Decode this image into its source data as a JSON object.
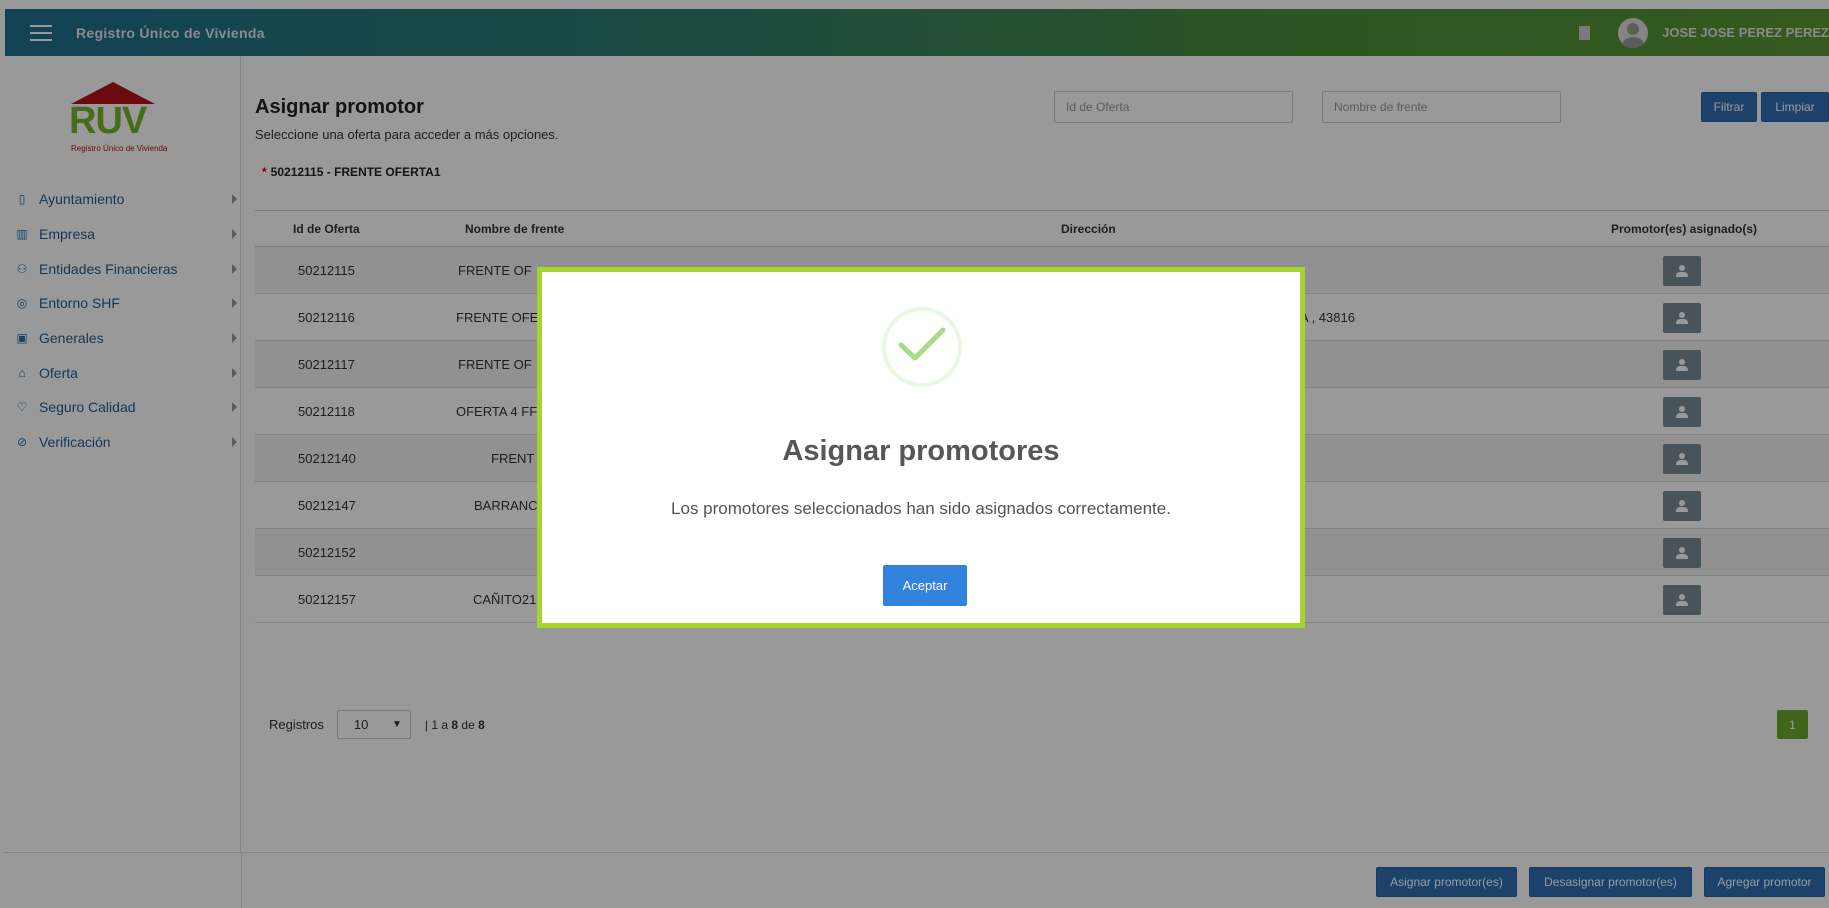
{
  "header": {
    "app_title": "Registro Único de Vivienda",
    "user_name": "JOSE JOSE PEREZ PEREZ"
  },
  "logo": {
    "text": "RUV",
    "subtitle": "Registro Único de Vivienda"
  },
  "sidebar": {
    "items": [
      {
        "label": "Ayuntamiento",
        "icon": "map-icon"
      },
      {
        "label": "Empresa",
        "icon": "building-icon"
      },
      {
        "label": "Entidades Financieras",
        "icon": "people-icon"
      },
      {
        "label": "Entorno SHF",
        "icon": "target-icon"
      },
      {
        "label": "Generales",
        "icon": "id-card-icon"
      },
      {
        "label": "Oferta",
        "icon": "house-hand-icon"
      },
      {
        "label": "Seguro Calidad",
        "icon": "handshake-icon"
      },
      {
        "label": "Verificación",
        "icon": "check-circle-icon"
      }
    ]
  },
  "main": {
    "title": "Asignar promotor",
    "subtitle": "Seleccione una oferta para acceder a más opciones.",
    "selected_offer": "50212115 - FRENTE OFERTA1",
    "filters": {
      "id_placeholder": "Id de Oferta",
      "name_placeholder": "Nombre de frente",
      "filter_label": "Filtrar",
      "clear_label": "Limpiar"
    },
    "table": {
      "headers": [
        "Id de Oferta",
        "Nombre de frente",
        "Dirección",
        "Promotor(es) asignado(s)"
      ],
      "rows": [
        {
          "id": "50212115",
          "name": "FRENTE OF",
          "address": ""
        },
        {
          "id": "50212116",
          "name": "FRENTE OFE",
          "address": "A , 43816"
        },
        {
          "id": "50212117",
          "name": "FRENTE OF",
          "address": ""
        },
        {
          "id": "50212118",
          "name": "OFERTA 4 FF",
          "address": ""
        },
        {
          "id": "50212140",
          "name": "FRENT",
          "address": ""
        },
        {
          "id": "50212147",
          "name": "BARRANC",
          "address": ""
        },
        {
          "id": "50212152",
          "name": "",
          "address": ""
        },
        {
          "id": "50212157",
          "name": "CAÑITO21",
          "address": ""
        }
      ]
    },
    "pager": {
      "label": "Registros",
      "page_size": "10",
      "info_prefix": "| 1 a ",
      "info_to": "8",
      "info_mid": " de ",
      "info_total": "8",
      "current_page": "1"
    }
  },
  "footer": {
    "assign_label": "Asignar promotor(es)",
    "unassign_label": "Desasignar promotor(es)",
    "add_label": "Agregar promotor"
  },
  "modal": {
    "title": "Asignar promotores",
    "message": "Los promotores seleccionados han sido asignados correctamente.",
    "button_label": "Aceptar"
  },
  "colors": {
    "header_start": "#1e6e8d",
    "header_end": "#5a9632",
    "primary_button": "#2f6eb5",
    "modal_border": "#a6d32e",
    "success_check": "#a5dc86",
    "page_active": "#6aaa2e"
  }
}
